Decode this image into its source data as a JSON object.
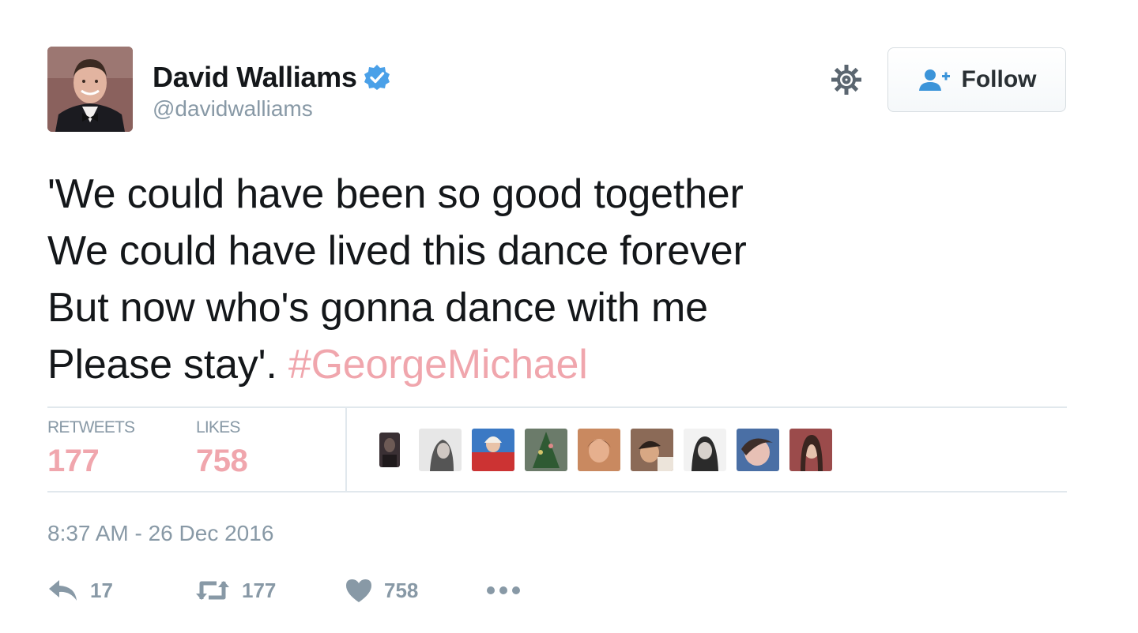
{
  "user": {
    "display_name": "David Walliams",
    "handle": "@davidwalliams",
    "verified_icon": "verified-badge-icon"
  },
  "header": {
    "follow_label": "Follow"
  },
  "tweet": {
    "lines": [
      "'We could have been so good together",
      "We could have lived this dance forever",
      "But now who's gonna dance with me",
      "Please stay'."
    ],
    "hashtag": "#GeorgeMichael"
  },
  "stats": {
    "retweets_label": "RETWEETS",
    "retweets_value": "177",
    "likes_label": "LIKES",
    "likes_value": "758"
  },
  "timestamp": "8:37 AM - 26 Dec 2016",
  "actions": {
    "reply_count": "17",
    "retweet_count": "177",
    "like_count": "758"
  },
  "colors": {
    "accent": "#f0a6ad",
    "muted": "#8899a6",
    "verified": "#4aa0e8",
    "follow_icon": "#3b94d9"
  }
}
